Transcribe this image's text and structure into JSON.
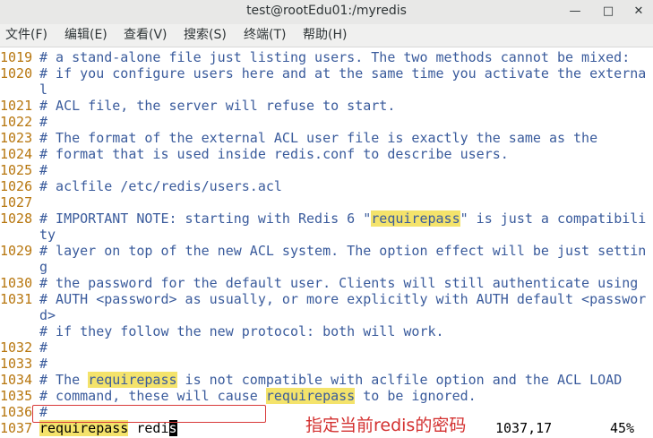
{
  "window": {
    "title": "test@rootEdu01:/myredis",
    "minimize_label": "—",
    "maximize_label": "□",
    "close_label": "✕"
  },
  "menu": {
    "items": [
      {
        "label": "文件(F)"
      },
      {
        "label": "编辑(E)"
      },
      {
        "label": "查看(V)"
      },
      {
        "label": "搜索(S)"
      },
      {
        "label": "终端(T)"
      },
      {
        "label": "帮助(H)"
      }
    ]
  },
  "editor": {
    "lines": [
      {
        "num": "1019",
        "segs": [
          {
            "t": "# a stand-alone file just listing users. The two methods cannot be mixed:"
          }
        ]
      },
      {
        "num": "1020",
        "segs": [
          {
            "t": "# if you configure users here and at the same time you activate the externa"
          }
        ]
      },
      {
        "num": "",
        "segs": [
          {
            "t": "l"
          }
        ]
      },
      {
        "num": "1021",
        "segs": [
          {
            "t": "# ACL file, the server will refuse to start."
          }
        ]
      },
      {
        "num": "1022",
        "segs": [
          {
            "t": "#"
          }
        ]
      },
      {
        "num": "1023",
        "segs": [
          {
            "t": "# The format of the external ACL user file is exactly the same as the"
          }
        ]
      },
      {
        "num": "1024",
        "segs": [
          {
            "t": "# format that is used inside redis.conf to describe users."
          }
        ]
      },
      {
        "num": "1025",
        "segs": [
          {
            "t": "#"
          }
        ]
      },
      {
        "num": "1026",
        "segs": [
          {
            "t": "# aclfile /etc/redis/users.acl"
          }
        ]
      },
      {
        "num": "1027",
        "segs": [
          {
            "t": ""
          }
        ]
      },
      {
        "num": "1028",
        "segs": [
          {
            "t": "# IMPORTANT NOTE: starting with Redis 6 \""
          },
          {
            "t": "requirepass",
            "hl": true
          },
          {
            "t": "\" is just a compatibili"
          }
        ]
      },
      {
        "num": "",
        "segs": [
          {
            "t": "ty"
          }
        ]
      },
      {
        "num": "1029",
        "segs": [
          {
            "t": "# layer on top of the new ACL system. The option effect will be just settin"
          }
        ]
      },
      {
        "num": "",
        "segs": [
          {
            "t": "g"
          }
        ]
      },
      {
        "num": "1030",
        "segs": [
          {
            "t": "# the password for the default user. Clients will still authenticate using"
          }
        ]
      },
      {
        "num": "1031",
        "segs": [
          {
            "t": "# AUTH <password> as usually, or more explicitly with AUTH default <passwor"
          }
        ]
      },
      {
        "num": "",
        "segs": [
          {
            "t": "d>"
          }
        ]
      },
      {
        "num": "",
        "segs": [
          {
            "t": "# if they follow the new protocol: both will work."
          }
        ]
      },
      {
        "num": "1032",
        "segs": [
          {
            "t": "#"
          }
        ]
      },
      {
        "num": "1033",
        "segs": [
          {
            "t": "#"
          }
        ]
      },
      {
        "num": "1034",
        "segs": [
          {
            "t": "# The "
          },
          {
            "t": "requirepass",
            "hl": true
          },
          {
            "t": " is not compatible with aclfile option and the ACL LOAD"
          }
        ]
      },
      {
        "num": "1035",
        "segs": [
          {
            "t": "# command, these will cause "
          },
          {
            "t": "requirepass",
            "hl": true
          },
          {
            "t": " to be ignored."
          }
        ]
      },
      {
        "num": "1036",
        "segs": [
          {
            "t": "#"
          }
        ]
      },
      {
        "num": "1037",
        "plain": true,
        "segs": [
          {
            "t": "requirepass",
            "hl": true
          },
          {
            "t": " redi"
          },
          {
            "t": "s",
            "cursor": true
          }
        ]
      }
    ]
  },
  "annotation": {
    "text": "指定当前redis的密码"
  },
  "status": {
    "position": "1037,17",
    "percent": "45%"
  }
}
